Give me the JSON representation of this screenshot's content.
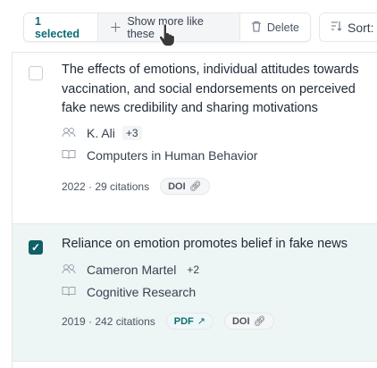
{
  "toolbar": {
    "selected_label": "1 selected",
    "more_like_label": "Show more like these",
    "delete_label": "Delete",
    "sort_label": "Sort:"
  },
  "papers": [
    {
      "title": "The effects of emotions, individual attitudes towards vaccination, and social endorsements on perceived fake news credibility and sharing motivations",
      "author": "K. Ali",
      "more_authors": "+3",
      "venue": "Computers in Human Behavior",
      "year_citations": "2022 · 29 citations",
      "doi_label": "DOI",
      "checked": false
    },
    {
      "title": "Reliance on emotion promotes belief in fake news",
      "author": "Cameron Martel",
      "more_authors": "+2",
      "venue": "Cognitive Research",
      "year_citations": "2019 · 242 citations",
      "pdf_label": "PDF",
      "doi_label": "DOI",
      "checked": true
    }
  ],
  "icons": {
    "plus": "plus-icon",
    "trash": "trash-icon",
    "sort": "sort-icon",
    "authors": "authors-icon",
    "venue": "book-icon",
    "link": "link-icon",
    "external": "external-link-icon"
  },
  "colors": {
    "accent": "#0f6b73",
    "selected_row_bg": "#eef5f5"
  }
}
